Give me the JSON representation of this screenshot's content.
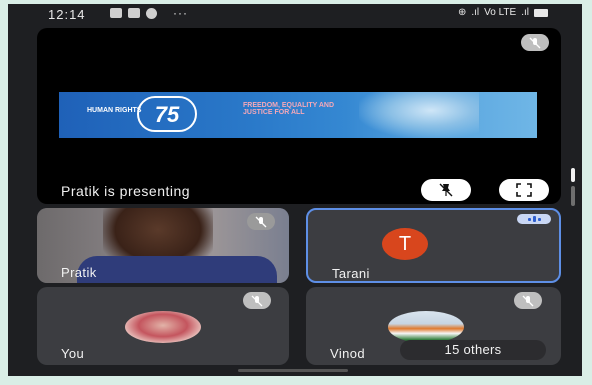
{
  "status_bar": {
    "time": "12:14",
    "more": "···",
    "right_text": "Vo LTE"
  },
  "presentation": {
    "banner": {
      "hr_text": "HUMAN RIGHTS",
      "number": "75",
      "slogan": "FREEDOM, EQUALITY AND JUSTICE FOR ALL"
    },
    "label": "Pratik is presenting",
    "unpin_icon": "pin-off-icon",
    "fullscreen_icon": "fullscreen-icon"
  },
  "participants": {
    "pratik": {
      "name": "Pratik"
    },
    "tarani": {
      "name": "Tarani",
      "initial": "T",
      "avatar_color": "#d8461d"
    },
    "you": {
      "name": "You"
    },
    "vinod": {
      "name": "Vinod",
      "others": "15 others"
    }
  },
  "colors": {
    "tile_bg": "#3c3d41",
    "active_border": "#5e8fe6",
    "screen_bg": "#1e1f22"
  }
}
